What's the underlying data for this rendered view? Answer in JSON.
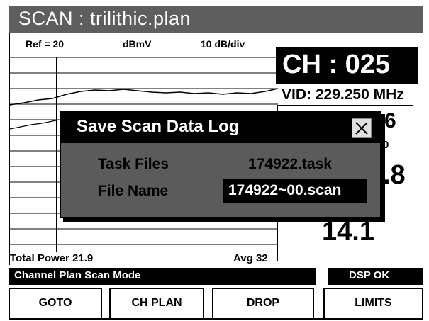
{
  "title": "SCAN : trilithic.plan",
  "plot": {
    "ref": "Ref = 20",
    "unit": "dBmV",
    "scale": "10 dB/div"
  },
  "channel": {
    "ch": "CH : 025",
    "vid": "VID: 229.250 MHz"
  },
  "readouts": {
    "partial_1": "6",
    "small_1": "0",
    "partial_2": ".8",
    "value_3": "14.1"
  },
  "dialog": {
    "title": "Save Scan Data Log",
    "task_label": "Task Files",
    "task_value": "174922.task",
    "file_label": "File Name",
    "file_value": "174922~00.scan"
  },
  "footer": {
    "total_power": "Total Power 21.9",
    "avg": "Avg 32",
    "mode": "Channel Plan Scan Mode",
    "dsp": "DSP OK"
  },
  "softkeys": [
    "GOTO",
    "CH PLAN",
    "DROP",
    "LIMITS"
  ],
  "icons": {
    "close": "close-icon"
  },
  "colors": {
    "title_bg": "#5e5e5e",
    "dialog_bg": "#5b5b5b",
    "bar_bg": "#000000"
  }
}
